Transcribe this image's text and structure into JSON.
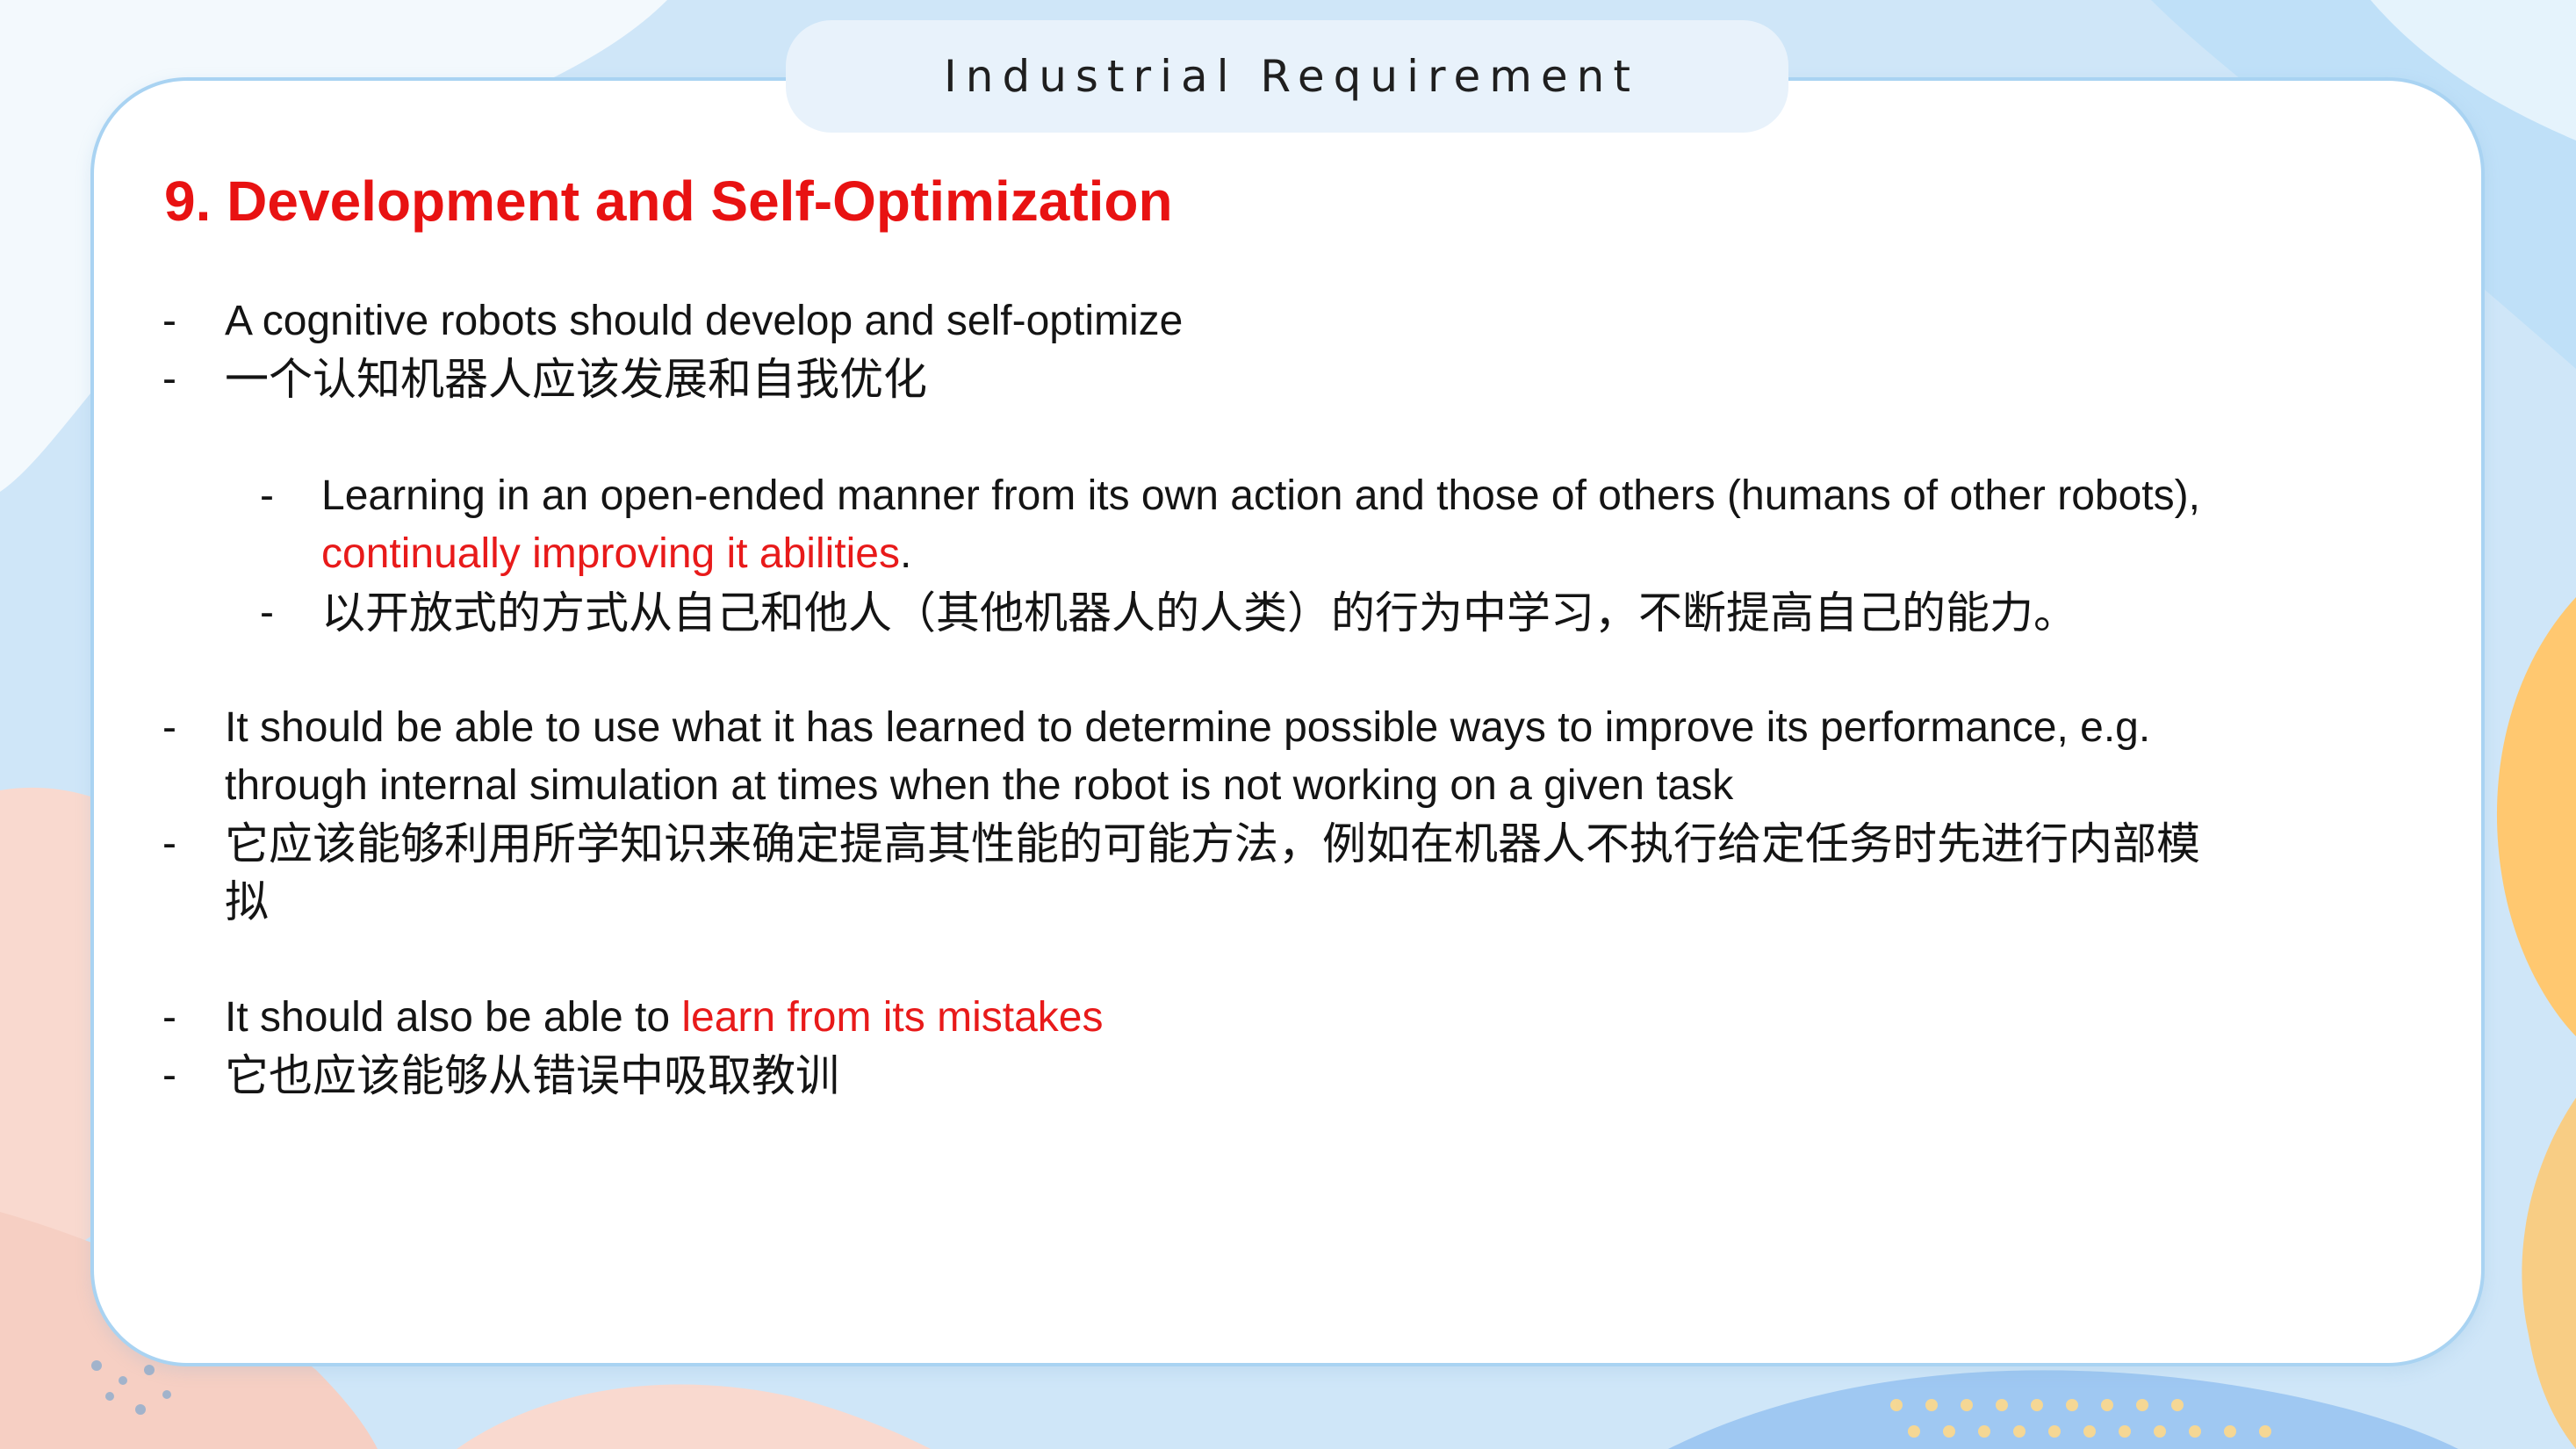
{
  "header": {
    "title": "Industrial Requirement"
  },
  "slide": {
    "heading": "9. Development and Self-Optimization"
  },
  "bullets": {
    "b1_en": "A cognitive robots should develop and self-optimize",
    "b1_zh": "一个认知机器人应该发展和自我优化",
    "sub_en_line1": "Learning in an open-ended manner from its own action and those of others (humans of other robots),",
    "sub_en_line2_red": "continually improving it abilities",
    "sub_en_line2_tail": ".",
    "sub_zh": "以开放式的方式从自己和他人（其他机器人的人类）的行为中学习，不断提高自己的能力。",
    "b2_en_line1": "It should be able to use what it has learned to determine possible ways to improve its performance, e.g.",
    "b2_en_line2": "through internal simulation at times when the robot is not working on a given task",
    "b2_zh_line1": "它应该能够利用所学知识来确定提高其性能的可能方法，例如在机器人不执行给定任务时先进行内部模",
    "b2_zh_line2": "拟",
    "b3_en_prefix": "It should also be able to ",
    "b3_en_red": "learn from its mistakes",
    "b3_zh": "它也应该能够从错误中吸取教训"
  },
  "colors": {
    "accent_red": "#e81212",
    "card_border": "#a9d3f2",
    "header_tab": "#e8f2fb"
  }
}
